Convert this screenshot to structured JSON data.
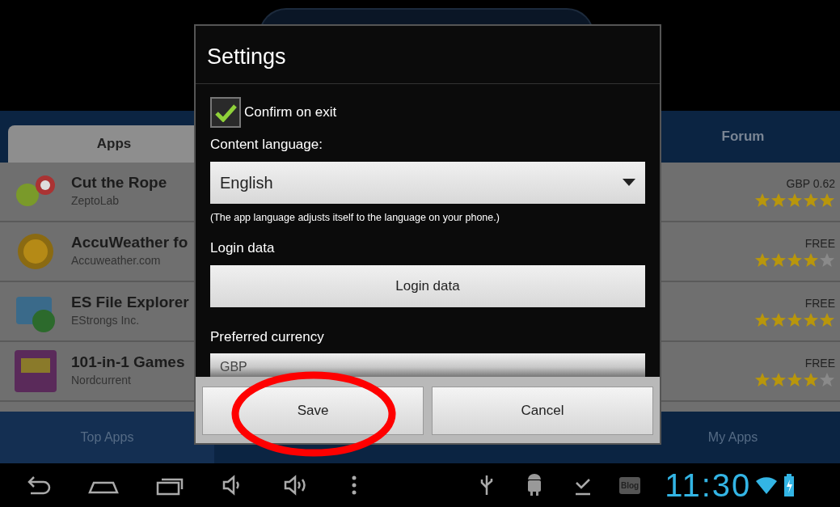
{
  "tabs": [
    {
      "label": "Apps",
      "selected": true
    },
    {
      "label": "Forum",
      "selected": false
    }
  ],
  "apps": [
    {
      "name": "Cut the Rope",
      "developer": "ZeptoLab",
      "price": "GBP 0.62",
      "stars": 5
    },
    {
      "name": "AccuWeather fo",
      "developer": "Accuweather.com",
      "price": "FREE",
      "stars": 4
    },
    {
      "name": "ES File Explorer",
      "developer": "EStrongs Inc.",
      "price": "FREE",
      "stars": 5
    },
    {
      "name": "101-in-1 Games",
      "developer": "Nordcurrent",
      "price": "FREE",
      "stars": 4
    }
  ],
  "bottom_tabs": [
    {
      "label": "Top Apps",
      "selected": true
    },
    {
      "label": "My Apps",
      "selected": false
    }
  ],
  "dialog": {
    "title": "Settings",
    "confirm_on_exit": {
      "label": "Confirm on exit",
      "checked": true
    },
    "content_language": {
      "label": "Content language:",
      "value": "English",
      "note": "(The app language adjusts itself to the language on your phone.)"
    },
    "login": {
      "label": "Login data",
      "button": "Login data"
    },
    "currency": {
      "label": "Preferred currency",
      "value": "GBP"
    },
    "buttons": [
      "Save",
      "Cancel"
    ]
  },
  "status_bar": {
    "time": "11:30",
    "notification_label": "Blog"
  }
}
